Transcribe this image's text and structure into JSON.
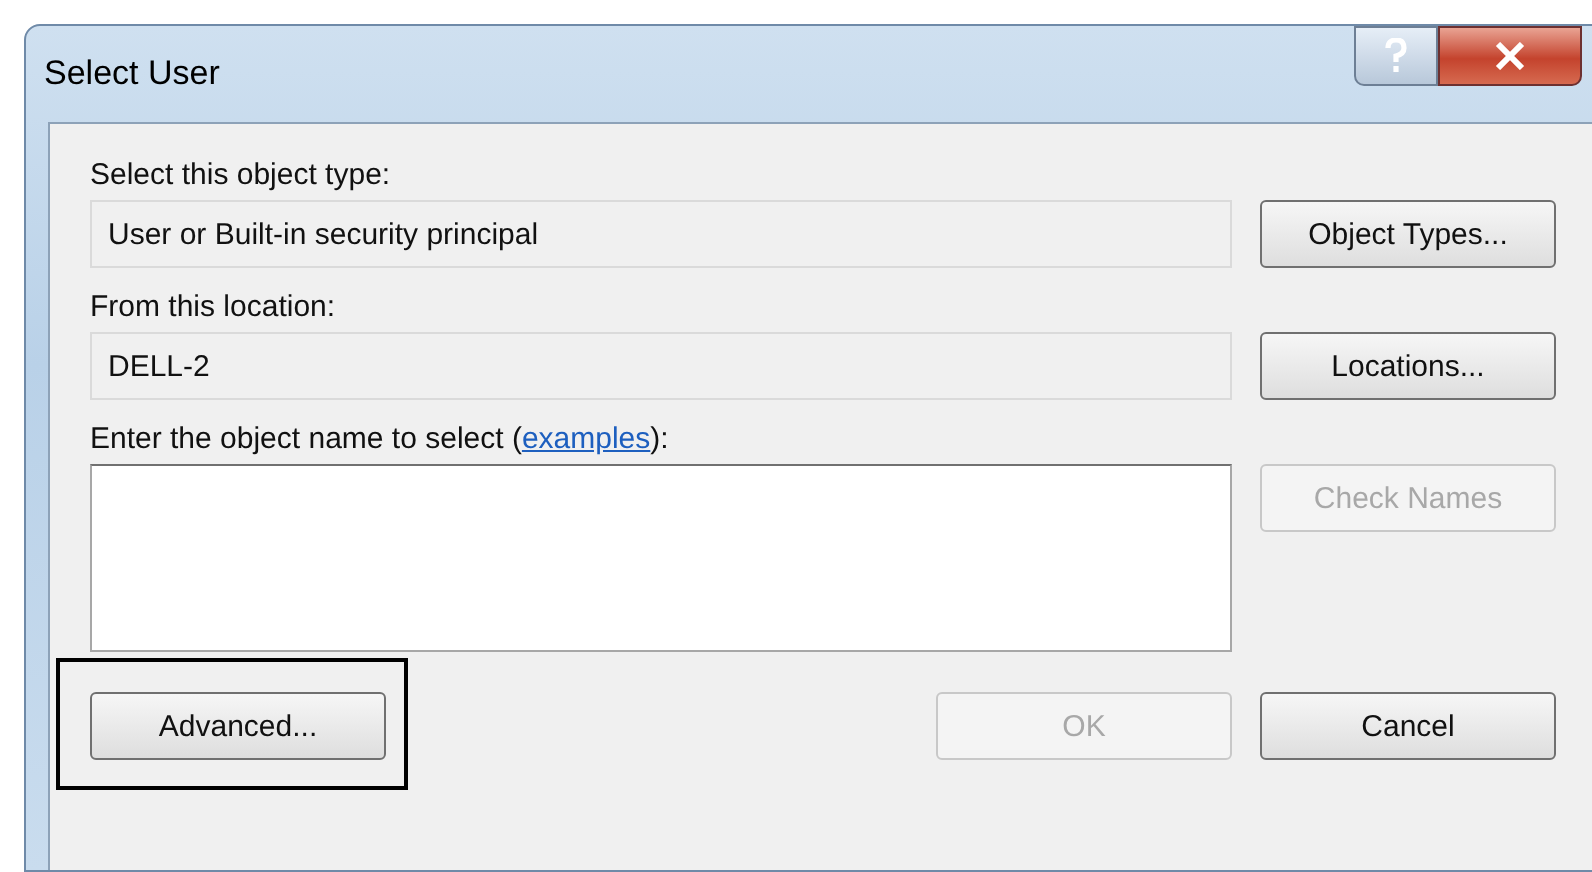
{
  "window": {
    "title": "Select User"
  },
  "object_type": {
    "label": "Select this object type:",
    "value": "User or Built-in security principal",
    "button": {
      "label": "Object Types...",
      "disabled": false
    }
  },
  "location": {
    "label": "From this location:",
    "value": "DELL-2",
    "button": {
      "label": "Locations...",
      "disabled": false
    }
  },
  "object_name": {
    "label": "Enter the object name to select (",
    "link": "examples",
    "label_end": "):",
    "button": {
      "label": "Check Names",
      "disabled": true
    }
  },
  "footer": {
    "advanced": {
      "label": "Advanced...",
      "disabled": false,
      "highlighted": true
    },
    "ok": {
      "label": "OK",
      "disabled": true
    },
    "cancel": {
      "label": "Cancel",
      "disabled": false
    }
  }
}
